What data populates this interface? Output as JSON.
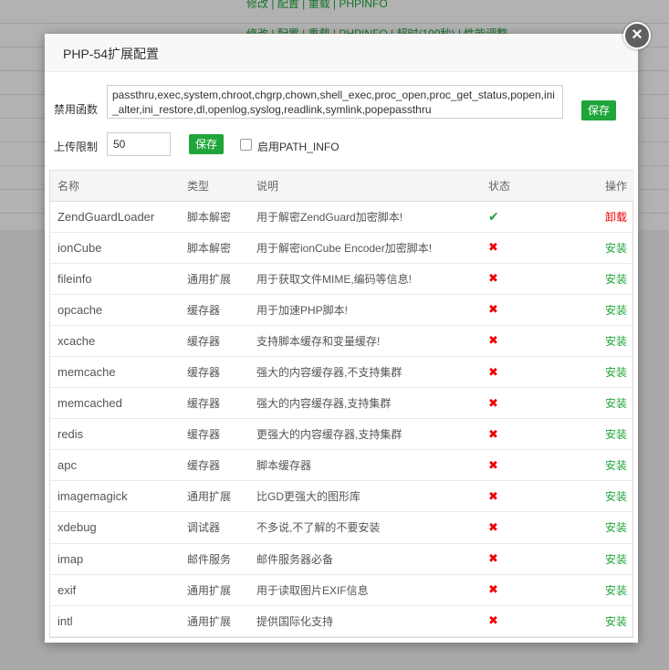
{
  "background": {
    "links_top": "修改 | 配置 | 重载 | PHPINFO",
    "links_second": "修改 | 配置 | 重载 | PHPINFO | 超时(100秒) | 性能调整"
  },
  "dialog": {
    "title": "PHP-54扩展配置",
    "close_glyph": "×"
  },
  "disable_functions": {
    "label": "禁用函数",
    "value": "passthru,exec,system,chroot,chgrp,chown,shell_exec,proc_open,proc_get_status,popen,ini_alter,ini_restore,dl,openlog,syslog,readlink,symlink,popepassthru",
    "save_label": "保存"
  },
  "upload_limit": {
    "label": "上传限制",
    "value": "50",
    "save_label": "保存"
  },
  "path_info": {
    "label": "启用PATH_INFO",
    "checked": false
  },
  "table": {
    "headers": [
      "名称",
      "类型",
      "说明",
      "状态",
      "操作"
    ],
    "rows": [
      {
        "name": "ZendGuardLoader",
        "type": "脚本解密",
        "desc": "用于解密ZendGuard加密脚本!",
        "status": "installed",
        "action": "卸载"
      },
      {
        "name": "ionCube",
        "type": "脚本解密",
        "desc": "用于解密ionCube Encoder加密脚本!",
        "status": "not-installed",
        "action": "安装"
      },
      {
        "name": "fileinfo",
        "type": "通用扩展",
        "desc": "用于获取文件MIME,编码等信息!",
        "status": "not-installed",
        "action": "安装"
      },
      {
        "name": "opcache",
        "type": "缓存器",
        "desc": "用于加速PHP脚本!",
        "status": "not-installed",
        "action": "安装"
      },
      {
        "name": "xcache",
        "type": "缓存器",
        "desc": "支持脚本缓存和变量缓存!",
        "status": "not-installed",
        "action": "安装"
      },
      {
        "name": "memcache",
        "type": "缓存器",
        "desc": "强大的内容缓存器,不支持集群",
        "status": "not-installed",
        "action": "安装"
      },
      {
        "name": "memcached",
        "type": "缓存器",
        "desc": "强大的内容缓存器,支持集群",
        "status": "not-installed",
        "action": "安装"
      },
      {
        "name": "redis",
        "type": "缓存器",
        "desc": "更强大的内容缓存器,支持集群",
        "status": "not-installed",
        "action": "安装"
      },
      {
        "name": "apc",
        "type": "缓存器",
        "desc": "脚本缓存器",
        "status": "not-installed",
        "action": "安装"
      },
      {
        "name": "imagemagick",
        "type": "通用扩展",
        "desc": "比GD更强大的图形库",
        "status": "not-installed",
        "action": "安装"
      },
      {
        "name": "xdebug",
        "type": "调试器",
        "desc": "不多说,不了解的不要安装",
        "status": "not-installed",
        "action": "安装"
      },
      {
        "name": "imap",
        "type": "邮件服务",
        "desc": "邮件服务器必备",
        "status": "not-installed",
        "action": "安装"
      },
      {
        "name": "exif",
        "type": "通用扩展",
        "desc": "用于读取图片EXIF信息",
        "status": "not-installed",
        "action": "安装"
      },
      {
        "name": "intl",
        "type": "通用扩展",
        "desc": "提供国际化支持",
        "status": "not-installed",
        "action": "安装"
      }
    ]
  },
  "icons": {
    "installed": "check-icon",
    "not_installed": "cross-icon"
  },
  "colors": {
    "accent": "#20a53a",
    "danger": "#ee0000",
    "overlay": "rgba(0,0,0,0.3)"
  }
}
